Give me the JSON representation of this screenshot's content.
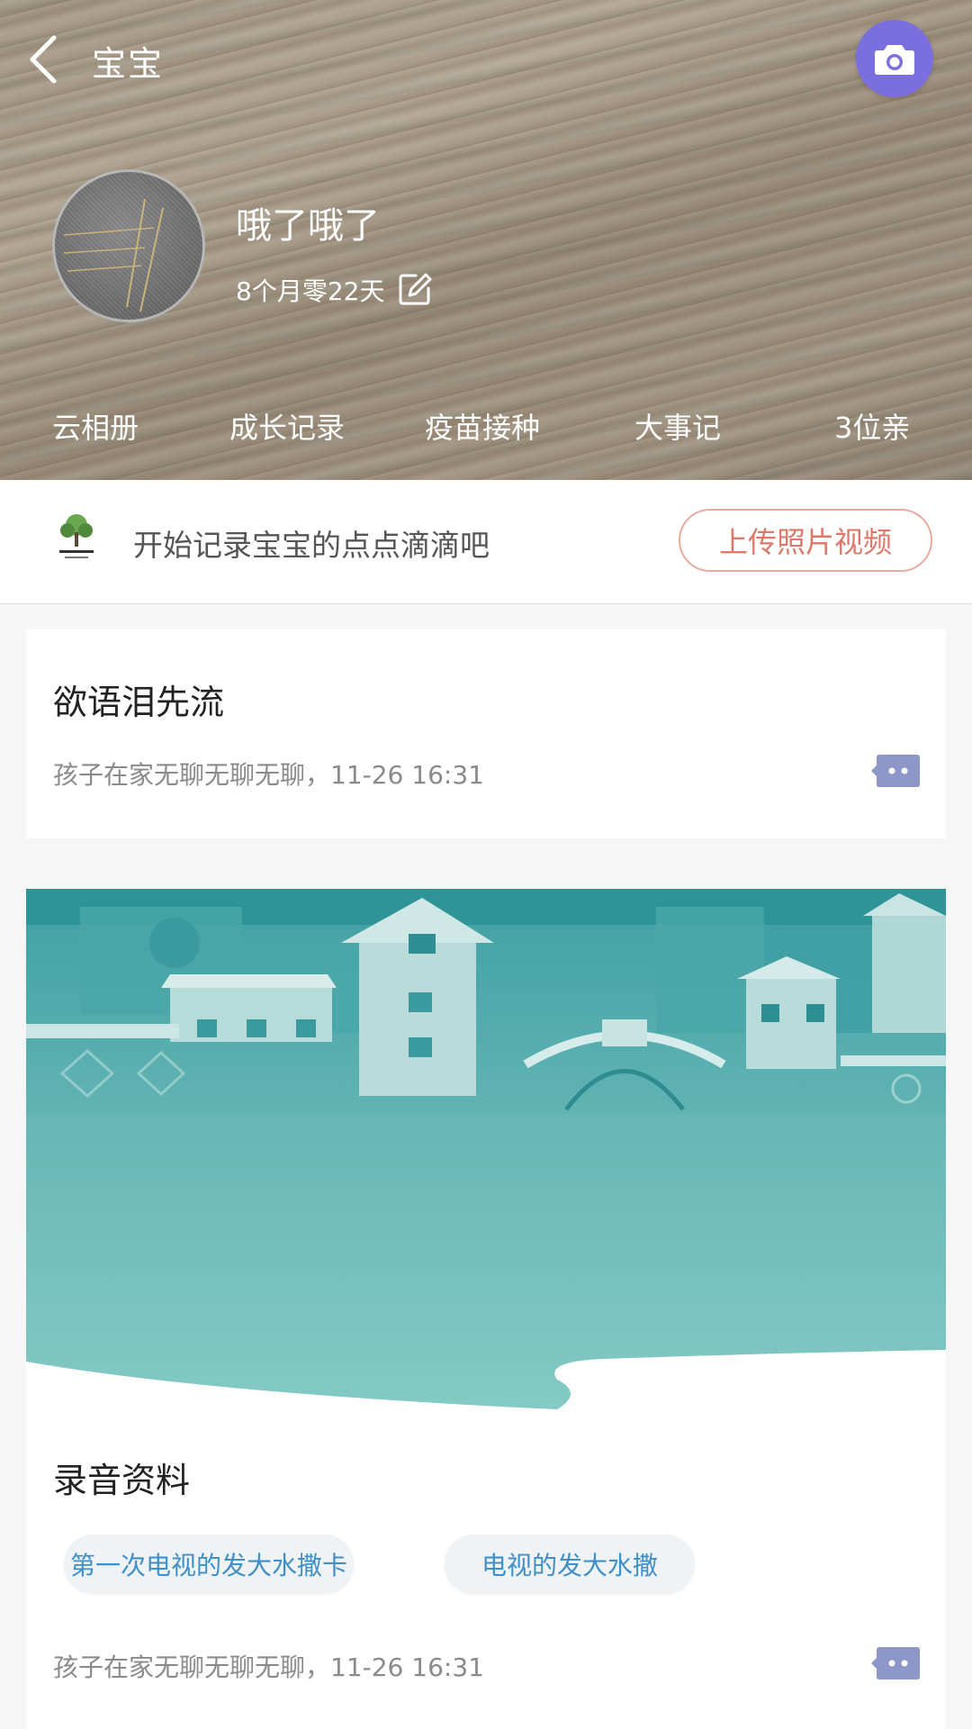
{
  "header": {
    "title": "宝宝",
    "baby_name": "哦了哦了",
    "baby_age": "8个月零22天",
    "nav_items": [
      "云相册",
      "成长记录",
      "疫苗接种",
      "大事记",
      "3位亲"
    ]
  },
  "prompt": {
    "text": "开始记录宝宝的点点滴滴吧",
    "upload_label": "上传照片视频"
  },
  "posts": [
    {
      "title": "欲语泪先流",
      "meta": "孩子在家无聊无聊无聊，11-26 16:31"
    },
    {
      "title": "录音资料",
      "tags": [
        "第一次电视的发大水撒卡",
        "电视的发大水撒"
      ],
      "meta": "孩子在家无聊无聊无聊，11-26 16:31"
    }
  ],
  "colors": {
    "camera_button": "#7b6fe0",
    "upload_accent": "#e0786a",
    "tag_text": "#3f8fc8",
    "comment_icon": "#8e98c8"
  },
  "icons": [
    "back-arrow-icon",
    "camera-icon",
    "edit-icon",
    "tree-logo-icon",
    "comment-icon"
  ]
}
